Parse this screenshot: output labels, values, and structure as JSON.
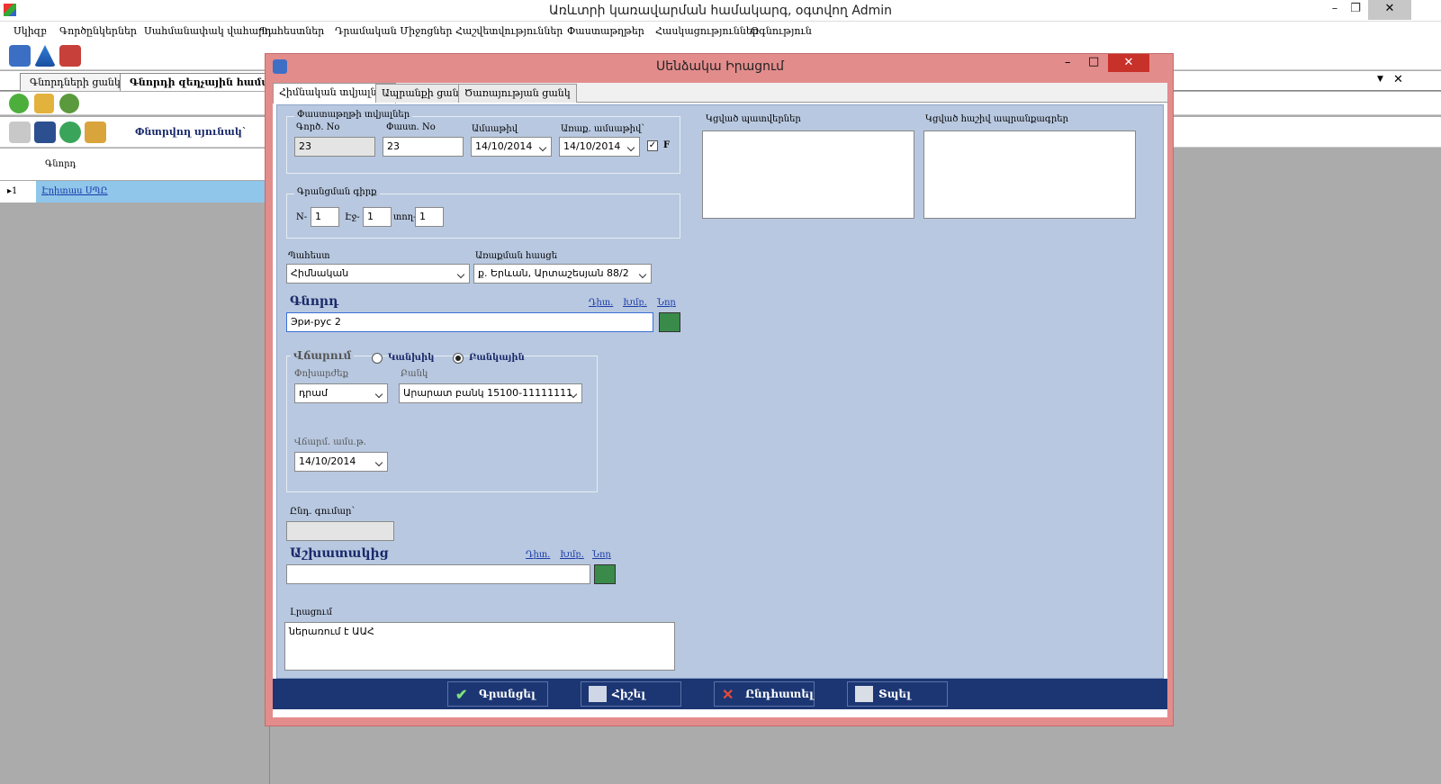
{
  "app": {
    "title": "Առևտրի կառավարման համակարգ, օգտվող Admin",
    "minimize": "–",
    "restore": "❐",
    "close": "✕"
  },
  "menu": [
    "Սկիզբ",
    "Գործընկերներ",
    "Սահմանափակ վահարդ",
    "Պահեստներ",
    "Դրամական Միջոցներ",
    "Հաշվետվություններ",
    "Փաստաթղթեր",
    "Հասկացություններ",
    "Օգնություն"
  ],
  "toolbar_icons": [
    "warehouse-icon",
    "pyramid-icon",
    "books-icon"
  ],
  "tabs": [
    "Գնորդների ցանկ",
    "Գնորդի զեղչային համակ"
  ],
  "tab_controls": {
    "dropdown": "▼",
    "close": "✕"
  },
  "filter_label": "Փնտրվող սյունակ`",
  "grid": {
    "header": "Գնորդ",
    "row_marker": "▸1",
    "row_value": "Էրիտաս ՍՊԸ"
  },
  "dialog": {
    "title": "Սենձակա Իրացում",
    "minimize": "–",
    "maximize": "□",
    "close": "✕",
    "tabs": [
      "Հիմնական տվյալներ",
      "Ապրանքի ցանկ",
      "Ծառայության ցանկ"
    ],
    "doc_group": "Փաստաթղթի տվյալներ",
    "doc_num_label": "Գործ. No",
    "doc_num": "23",
    "fact_num_label": "Փաստ. No",
    "fact_num": "23",
    "date_label": "Ամսաթիվ",
    "date": "14/10/2014",
    "sub_date_label": "Առաք. ամսաթիվ`",
    "sub_date": "14/10/2014",
    "f_flag": "F",
    "reg_group": "Գրանցման գիրք",
    "n_label": "N-",
    "n_val": "1",
    "page_label": "Էջ-",
    "page_val": "1",
    "row_label": "տող-",
    "row_val": "1",
    "warehouse_label": "Պահեստ",
    "warehouse": "Հիմնական",
    "address_label": "Առաքման հասցե",
    "address": "ք. Երևան, Արտաշեսյան 88/2",
    "buyer_label": "Գնորդ",
    "buyer": "Эри-рус 2",
    "links": {
      "view": "Դիտ.",
      "edit": "Խմբ.",
      "new": "Նոր"
    },
    "pay_group": "Վճարում",
    "cash_label": "Կանխիկ",
    "noncash_label": "Բանկային",
    "currency_label": "Փոխարժեք",
    "currency": "դրամ",
    "bank_label": "Բանկ",
    "bank": "Արարատ բանկ 15100-11111111",
    "pay_date_label": "Վճարմ. ամս.թ.",
    "pay_date": "14/10/2014",
    "total_label": "Ընդ. գումար`",
    "total": "",
    "worker_label": "Աշխատակից",
    "worker": "",
    "note_label": "Լրացում",
    "note": "ներառում է ԱԱՀ",
    "linked_orders_label": "Կցված պատվերներ",
    "linked_invoices_label": "Կցված հաշիվ ապրանքագրեր",
    "buttons": {
      "save": "Գրանցել",
      "delete": "Հիշել",
      "cancel": "Ընդհատել",
      "print": "Տպել"
    }
  }
}
